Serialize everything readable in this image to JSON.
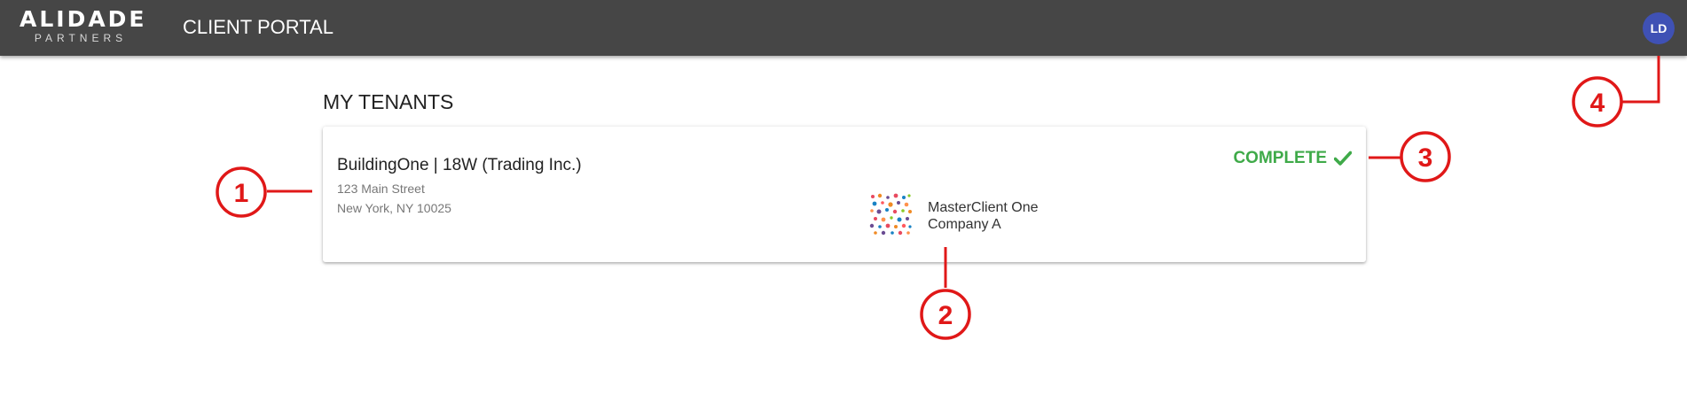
{
  "header": {
    "logo_main": "ALIDADE",
    "logo_sub": "PARTNERS",
    "title": "CLIENT PORTAL",
    "avatar_initials": "LD",
    "avatar_color": "#3f51b5",
    "bar_color": "#464646"
  },
  "main": {
    "section_title": "MY TENANTS",
    "tenants": [
      {
        "name": "BuildingOne | 18W (Trading Inc.)",
        "address_line1": "123 Main Street",
        "address_line2": "New York, NY 10025",
        "client_line1": "MasterClient One",
        "client_line2": "Company A",
        "status": "COMPLETE",
        "status_color": "#3faa49",
        "status_icon": "check-icon",
        "client_logo_icon": "dots-logo-icon"
      }
    ]
  },
  "annotations": {
    "color": "#e01818",
    "markers": [
      "1",
      "2",
      "3",
      "4"
    ]
  }
}
